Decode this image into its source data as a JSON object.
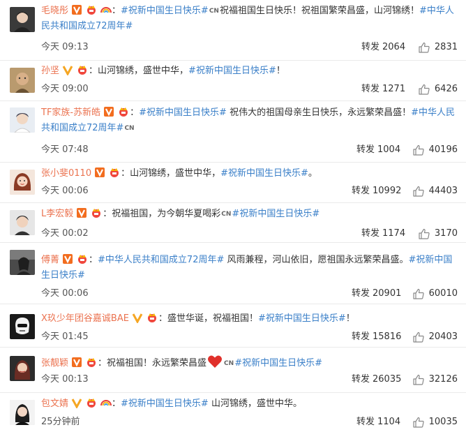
{
  "labels": {
    "repost": "转发"
  },
  "colors": {
    "username": "#eb7350",
    "topic_link": "#3a7fc8",
    "verified_badge": "#f26d1f",
    "heart": "#e0302b"
  },
  "posts": [
    {
      "user": "毛晓彤",
      "badges": [
        "verified-v-icon",
        "crown-badge-icon",
        "rainbow-badge-icon"
      ],
      "segments": [
        {
          "type": "sep",
          "text": "："
        },
        {
          "type": "topic",
          "text": "#祝新中国生日快乐#"
        },
        {
          "type": "cn",
          "text": "CN"
        },
        {
          "type": "text",
          "text": "祝福祖国生日快乐！祝祖国繁荣昌盛，山河锦绣！"
        },
        {
          "type": "topic",
          "text": "#中华人民共和国成立72周年#"
        }
      ],
      "time": "今天 09:13",
      "reposts": "2064",
      "likes": "2831"
    },
    {
      "user": "孙坚",
      "badges": [
        "verified-v-icon",
        "crown-badge-icon"
      ],
      "segments": [
        {
          "type": "sep",
          "text": "："
        },
        {
          "type": "text",
          "text": "山河锦绣，盛世中华，"
        },
        {
          "type": "topic",
          "text": "#祝新中国生日快乐#"
        },
        {
          "type": "text",
          "text": "！"
        }
      ],
      "time": "今天 09:00",
      "reposts": "1271",
      "likes": "6426"
    },
    {
      "user": "TF家族-苏新皓",
      "badges": [
        "verified-v-icon",
        "crown-badge-icon"
      ],
      "segments": [
        {
          "type": "sep",
          "text": "："
        },
        {
          "type": "topic",
          "text": "#祝新中国生日快乐#"
        },
        {
          "type": "text",
          "text": " 祝伟大的祖国母亲生日快乐，永远繁荣昌盛！"
        },
        {
          "type": "topic",
          "text": "#中华人民共和国成立72周年#"
        },
        {
          "type": "cn",
          "text": "CN"
        }
      ],
      "time": "今天 07:48",
      "reposts": "1004",
      "likes": "40196"
    },
    {
      "user": "张小斐0110",
      "badges": [
        "verified-v-icon",
        "crown-badge-icon"
      ],
      "segments": [
        {
          "type": "sep",
          "text": "："
        },
        {
          "type": "text",
          "text": "山河锦绣，盛世中华，"
        },
        {
          "type": "topic",
          "text": "#祝新中国生日快乐#"
        },
        {
          "type": "text",
          "text": "。"
        }
      ],
      "time": "今天 00:06",
      "reposts": "10992",
      "likes": "44403"
    },
    {
      "user": "L李宏毅",
      "badges": [
        "verified-v-icon",
        "crown-badge-icon"
      ],
      "segments": [
        {
          "type": "sep",
          "text": "："
        },
        {
          "type": "text",
          "text": "祝福祖国，为今朝华夏喝彩"
        },
        {
          "type": "cn",
          "text": "CN"
        },
        {
          "type": "topic",
          "text": "#祝新中国生日快乐#"
        }
      ],
      "time": "今天 00:02",
      "reposts": "1174",
      "likes": "3170"
    },
    {
      "user": "傅菁",
      "badges": [
        "verified-v-icon",
        "crown-badge-icon"
      ],
      "segments": [
        {
          "type": "sep",
          "text": "："
        },
        {
          "type": "topic",
          "text": "#中华人民共和国成立72周年#"
        },
        {
          "type": "text",
          "text": " 风雨兼程，河山依旧，愿祖国永远繁荣昌盛。"
        },
        {
          "type": "topic",
          "text": "#祝新中国生日快乐#"
        }
      ],
      "time": "今天 00:06",
      "reposts": "20901",
      "likes": "60010"
    },
    {
      "user": "X玖少年团谷嘉诚BAE",
      "badges": [
        "verified-v-icon",
        "crown-badge-icon"
      ],
      "segments": [
        {
          "type": "sep",
          "text": "："
        },
        {
          "type": "text",
          "text": "盛世华诞，祝福祖国！"
        },
        {
          "type": "topic",
          "text": "#祝新中国生日快乐#"
        },
        {
          "type": "text",
          "text": "！"
        }
      ],
      "time": "今天 01:45",
      "reposts": "15816",
      "likes": "20403"
    },
    {
      "user": "张靓颖",
      "badges": [
        "verified-v-icon",
        "crown-badge-icon"
      ],
      "segments": [
        {
          "type": "sep",
          "text": "："
        },
        {
          "type": "text",
          "text": "祝福祖国！永远繁荣昌盛"
        },
        {
          "type": "heart",
          "text": ""
        },
        {
          "type": "cn",
          "text": "CN"
        },
        {
          "type": "topic",
          "text": "#祝新中国生日快乐#"
        }
      ],
      "time": "今天 00:13",
      "reposts": "26035",
      "likes": "32126"
    },
    {
      "user": "包文婧",
      "badges": [
        "verified-v-icon",
        "crown-badge-icon",
        "rainbow-badge-icon"
      ],
      "segments": [
        {
          "type": "sep",
          "text": "："
        },
        {
          "type": "topic",
          "text": "#祝新中国生日快乐#"
        },
        {
          "type": "text",
          "text": " 山河锦绣，盛世中华。"
        }
      ],
      "time": "25分钟前",
      "reposts": "1104",
      "likes": "10035"
    }
  ]
}
